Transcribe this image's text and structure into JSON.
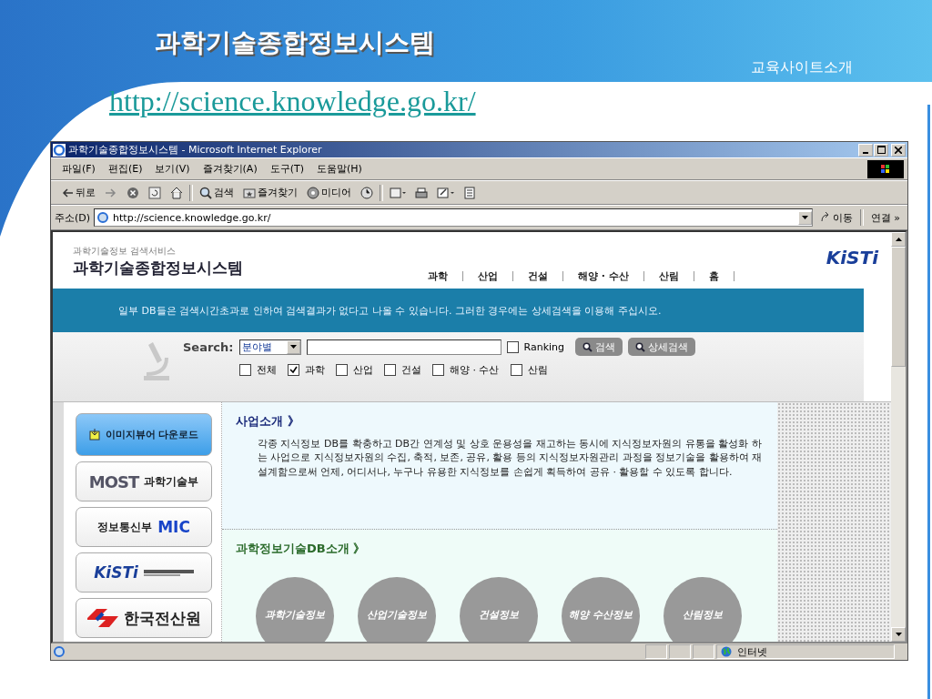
{
  "slide": {
    "title": "과학기술종합정보시스템",
    "corner_label": "교육사이트소개",
    "link": "http://science.knowledge.go.kr/"
  },
  "window": {
    "title": "과학기술종합정보시스템 - Microsoft Internet Explorer"
  },
  "menu": [
    "파일(F)",
    "편집(E)",
    "보기(V)",
    "즐겨찾기(A)",
    "도구(T)",
    "도움말(H)"
  ],
  "toolbar": [
    {
      "kind": "back",
      "label": "뒤로"
    },
    {
      "kind": "forward"
    },
    {
      "kind": "stop"
    },
    {
      "kind": "refresh"
    },
    {
      "kind": "home"
    },
    {
      "kind": "search",
      "label": "검색"
    },
    {
      "kind": "favorites",
      "label": "즐겨찾기"
    },
    {
      "kind": "media",
      "label": "미디어"
    },
    {
      "kind": "history"
    },
    {
      "kind": "mail"
    },
    {
      "kind": "print"
    },
    {
      "kind": "edit"
    },
    {
      "kind": "discuss"
    }
  ],
  "address": {
    "label": "주소(D)",
    "value": "http://science.knowledge.go.kr/",
    "go": "이동",
    "links": "연결 »"
  },
  "site": {
    "subtitle": "과학기술정보 검색서비스",
    "title": "과학기술종합정보시스템",
    "nav": [
      "과학",
      "산업",
      "건설",
      "해양 · 수산",
      "산림",
      "홈"
    ],
    "logo": "KiSTi",
    "notice": "일부 DB들은 검색시간초과로 인하여 검색결과가 없다고 나올 수 있습니다. 그러한 경우에는 상세검색을 이용해 주십시오.",
    "search": {
      "label": "Search:",
      "category": "분야별",
      "ranking": {
        "label": "Ranking",
        "checked": false
      },
      "buttons": [
        "검색",
        "상세검색"
      ],
      "filters": [
        {
          "label": "전체",
          "checked": false
        },
        {
          "label": "과학",
          "checked": true
        },
        {
          "label": "산업",
          "checked": false
        },
        {
          "label": "건설",
          "checked": false
        },
        {
          "label": "해양 · 수산",
          "checked": false
        },
        {
          "label": "산림",
          "checked": false
        }
      ]
    },
    "side_links": [
      {
        "kind": "download",
        "label": "이미지뷰어 다운로드"
      },
      {
        "kind": "most",
        "logo": "MOST",
        "label": "과학기술부"
      },
      {
        "kind": "mic",
        "label": "정보통신부",
        "logo": "MIC"
      },
      {
        "kind": "kisti",
        "logo": "KiSTi"
      },
      {
        "kind": "nca",
        "label": "한국전산원"
      }
    ],
    "intro": {
      "heading": "사업소개 》",
      "text": "각종 지식정보 DB를 확충하고 DB간 연계성 및 상호 운용성을 재고하는 동시에 지식정보자원의 유통을 활성화 하는 사업으로 지식정보자원의 수집, 축적, 보존, 공유, 활용 등의 지식정보자원관리 과정을 정보기술을 활용하여 재설계함으로써 언제, 어디서나, 누구나 유용한 지식정보를 손쉽게 획득하여 공유 · 활용할 수 있도록 합니다."
    },
    "db": {
      "heading": "과학정보기술DB소개 》",
      "items": [
        "과학기술정보",
        "산업기술정보",
        "건설정보",
        "해양 수산정보",
        "산림정보"
      ]
    }
  },
  "status_bar": {
    "zone": "인터넷"
  }
}
